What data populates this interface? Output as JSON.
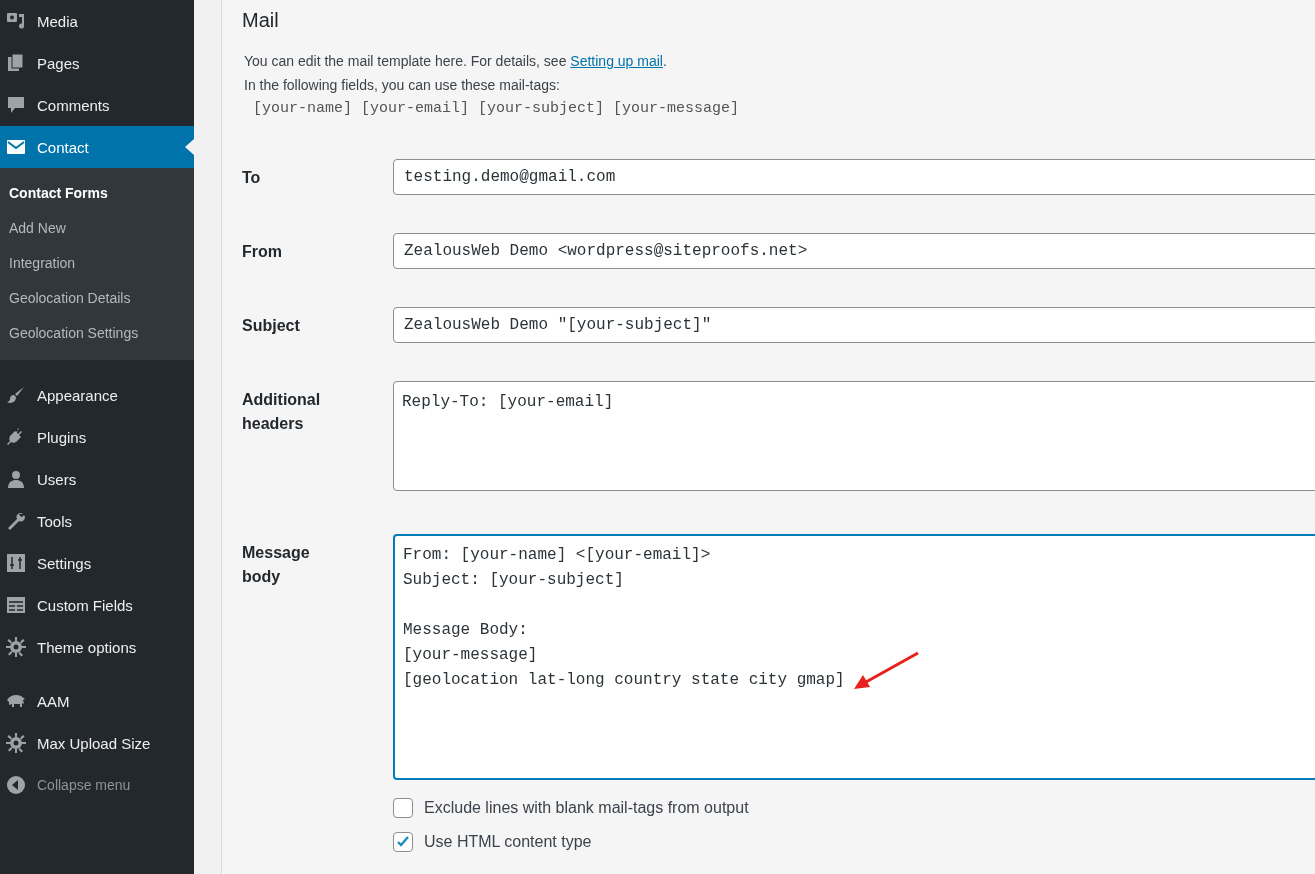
{
  "sidebar": {
    "groups": [
      {
        "items": [
          {
            "label": "Media",
            "selected": false
          },
          {
            "label": "Pages",
            "selected": false
          },
          {
            "label": "Comments",
            "selected": false
          },
          {
            "label": "Contact",
            "selected": true,
            "children": [
              {
                "label": "Contact Forms",
                "selected": true
              },
              {
                "label": "Add New",
                "selected": false
              },
              {
                "label": "Integration",
                "selected": false
              },
              {
                "label": "Geolocation Details",
                "selected": false
              },
              {
                "label": "Geolocation Settings",
                "selected": false
              }
            ]
          }
        ]
      },
      {
        "items": [
          {
            "label": "Appearance",
            "selected": false
          },
          {
            "label": "Plugins",
            "selected": false
          },
          {
            "label": "Users",
            "selected": false
          },
          {
            "label": "Tools",
            "selected": false
          },
          {
            "label": "Settings",
            "selected": false
          },
          {
            "label": "Custom Fields",
            "selected": false
          },
          {
            "label": "Theme options",
            "selected": false
          }
        ]
      },
      {
        "items": [
          {
            "label": "AAM",
            "selected": false
          },
          {
            "label": "Max Upload Size",
            "selected": false
          }
        ]
      }
    ],
    "collapse": "Collapse menu"
  },
  "mail": {
    "title": "Mail",
    "intro": "You can edit the mail template here. For details, see ",
    "link": "Setting up mail",
    "intro_end": ".",
    "note": "In the following fields, you can use these mail-tags:",
    "tags": "[your-name] [your-email] [your-subject] [your-message]",
    "fields": [
      {
        "label": "To",
        "kind": "input",
        "value": "testing.demo@gmail.com"
      },
      {
        "label": "From",
        "kind": "input",
        "value": "ZealousWeb Demo <wordpress@siteproofs.net>"
      },
      {
        "label": "Subject",
        "kind": "input",
        "value": "ZealousWeb Demo \"[your-subject]\""
      },
      {
        "label": "Additional headers",
        "kind": "textarea",
        "focused": false,
        "value": "Reply-To: [your-email]"
      },
      {
        "label": "Message body",
        "kind": "textarea",
        "focused": true,
        "value": "From: [your-name] <[your-email]>\nSubject: [your-subject]\n\nMessage Body:\n[your-message]\n[geolocation lat-long country state city gmap]"
      }
    ],
    "options": [
      {
        "label": "Exclude lines with blank mail-tags from output",
        "checked": false
      },
      {
        "label": "Use HTML content type",
        "checked": true
      }
    ]
  }
}
